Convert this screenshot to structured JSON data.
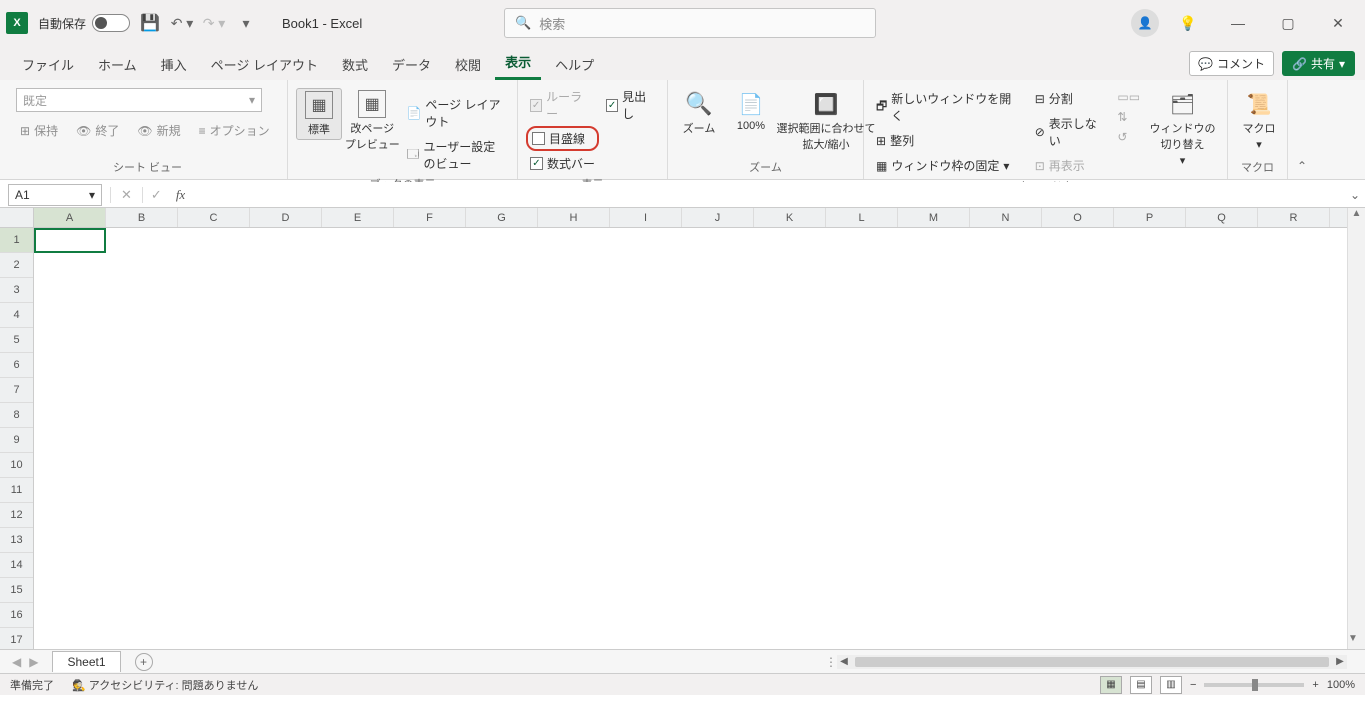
{
  "titlebar": {
    "autosave_label": "自動保存",
    "autosave_state": "オフ",
    "doc_title": "Book1  -  Excel",
    "search_placeholder": "検索"
  },
  "tabs": {
    "file": "ファイル",
    "home": "ホーム",
    "insert": "挿入",
    "pagelayout": "ページ レイアウト",
    "formulas": "数式",
    "data": "データ",
    "review": "校閲",
    "view": "表示",
    "help": "ヘルプ"
  },
  "tab_right": {
    "comments": "コメント",
    "share": "共有"
  },
  "ribbon": {
    "sheetview": {
      "selector": "既定",
      "keep": "保持",
      "exit": "終了",
      "new": "新規",
      "options": "オプション",
      "group": "シート ビュー"
    },
    "bookview": {
      "normal": "標準",
      "pagebreak": "改ページ\nプレビュー",
      "pagelayout": "ページ レイアウト",
      "custom": "ユーザー設定のビュー",
      "group": "ブックの表示"
    },
    "show": {
      "ruler": "ルーラー",
      "headings": "見出し",
      "gridlines": "目盛線",
      "formulabar": "数式バー",
      "group": "表示"
    },
    "zoom": {
      "zoom": "ズーム",
      "p100": "100%",
      "selection": "選択範囲に合わせて\n拡大/縮小",
      "group": "ズーム"
    },
    "window": {
      "newwin": "新しいウィンドウを開く",
      "arrange": "整列",
      "freeze": "ウィンドウ枠の固定",
      "split": "分割",
      "hide": "表示しない",
      "unhide": "再表示",
      "switch": "ウィンドウの\n切り替え",
      "group": "ウィンドウ"
    },
    "macro": {
      "macros": "マクロ",
      "group": "マクロ"
    }
  },
  "fbar": {
    "namebox": "A1"
  },
  "grid": {
    "cols": [
      "A",
      "B",
      "C",
      "D",
      "E",
      "F",
      "G",
      "H",
      "I",
      "J",
      "K",
      "L",
      "M",
      "N",
      "O",
      "P",
      "Q",
      "R"
    ],
    "rows": [
      "1",
      "2",
      "3",
      "4",
      "5",
      "6",
      "7",
      "8",
      "9",
      "10",
      "11",
      "12",
      "13",
      "14",
      "15",
      "16",
      "17"
    ]
  },
  "sheettabs": {
    "sheet1": "Sheet1"
  },
  "status": {
    "ready": "準備完了",
    "accessibility": "アクセシビリティ: 問題ありません",
    "zoom": "100%"
  }
}
